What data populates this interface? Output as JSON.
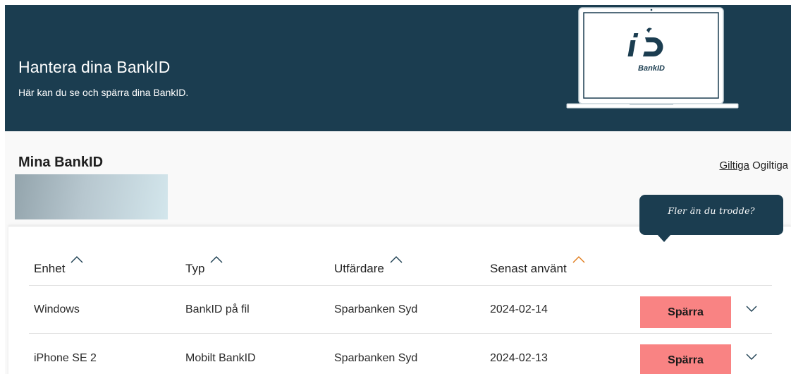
{
  "hero": {
    "title": "Hantera dina BankID",
    "subtitle": "Här kan du se och spärra dina BankID.",
    "logo_text": "BankID"
  },
  "section": {
    "title": "Mina BankID",
    "filters": [
      {
        "label": "Giltiga",
        "active": true
      },
      {
        "label": "Ogiltiga",
        "active": false
      }
    ]
  },
  "tooltip": {
    "text": "Fler än du trodde?"
  },
  "table": {
    "columns": [
      {
        "label": "Enhet",
        "sorted": false
      },
      {
        "label": "Typ",
        "sorted": false
      },
      {
        "label": "Utfärdare",
        "sorted": false
      },
      {
        "label": "Senast använt",
        "sorted": true
      }
    ],
    "rows": [
      {
        "device": "Windows",
        "type": "BankID på fil",
        "issuer": "Sparbanken Syd",
        "last_used": "2024-02-14",
        "action": "Spärra"
      },
      {
        "device": "iPhone SE 2",
        "type": "Mobilt BankID",
        "issuer": "Sparbanken Syd",
        "last_used": "2024-02-13",
        "action": "Spärra"
      }
    ]
  },
  "colors": {
    "brand_dark": "#1b3d50",
    "block_button": "#f98383",
    "sort_active": "#e07b1a",
    "sort_inactive": "#1b3d50"
  },
  "icons": {
    "sort": "chevron-up-icon",
    "expand": "chevron-down-icon",
    "device": "laptop-icon",
    "logo": "bankid-logo-icon"
  }
}
